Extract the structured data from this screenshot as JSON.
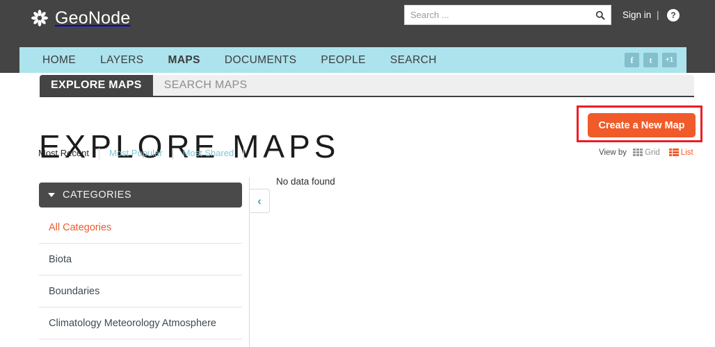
{
  "header": {
    "brand": "GeoNode",
    "brand_icon": "pinwheel-logo-icon",
    "search": {
      "placeholder": "Search ...",
      "value": "",
      "button_icon": "search-icon"
    },
    "signin_label": "Sign in",
    "separator": "|",
    "help_label": "?"
  },
  "nav": {
    "items": [
      {
        "label": "HOME",
        "active": false
      },
      {
        "label": "LAYERS",
        "active": false
      },
      {
        "label": "MAPS",
        "active": true
      },
      {
        "label": "DOCUMENTS",
        "active": false
      },
      {
        "label": "PEOPLE",
        "active": false
      },
      {
        "label": "SEARCH",
        "active": false
      }
    ],
    "social": [
      {
        "label": "f",
        "name": "facebook-icon"
      },
      {
        "label": "t",
        "name": "twitter-icon"
      },
      {
        "label": "+1",
        "name": "googleplus-icon"
      }
    ]
  },
  "tabs": [
    {
      "label": "EXPLORE MAPS",
      "active": true
    },
    {
      "label": "SEARCH MAPS",
      "active": false
    }
  ],
  "page": {
    "title": "EXPLORE MAPS",
    "create_button": "Create a New Map",
    "no_data": "No data found"
  },
  "sort": {
    "options": [
      {
        "label": "Most Recent",
        "active": true
      },
      {
        "label": "Most Popular",
        "active": false
      },
      {
        "label": "Most Shared",
        "active": false
      }
    ]
  },
  "viewby": {
    "label": "View by",
    "grid_label": "Grid",
    "list_label": "List"
  },
  "sidebar": {
    "header": "CATEGORIES",
    "categories": [
      {
        "label": "All Categories",
        "active": true
      },
      {
        "label": "Biota",
        "active": false
      },
      {
        "label": "Boundaries",
        "active": false
      },
      {
        "label": "Climatology Meteorology Atmosphere",
        "active": false
      }
    ]
  },
  "colors": {
    "header_dark": "#444444",
    "nav_blue": "#ace3ed",
    "accent_orange": "#f15a29",
    "highlight_red": "#ee1c25",
    "link_blue": "#7fc6d8",
    "tab_gray": "#efefef"
  }
}
